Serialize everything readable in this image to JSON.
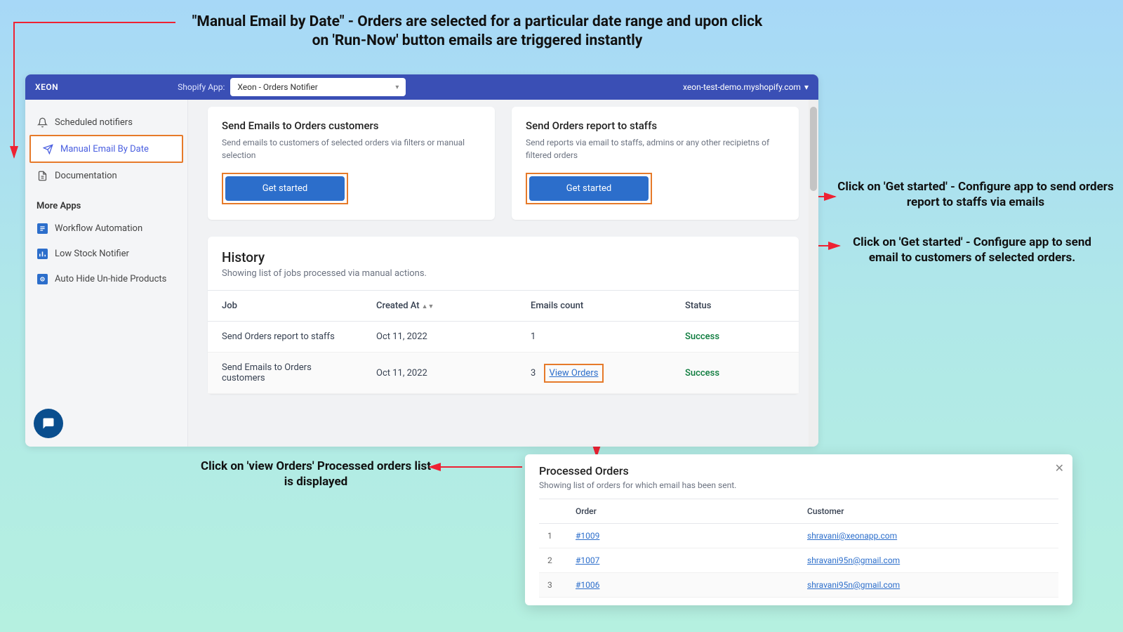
{
  "annotations": {
    "top": "\"Manual Email by Date\" - Orders are selected for a particular date range and upon click on 'Run-Now' button emails are triggered instantly",
    "right1": "Click on 'Get started' - Configure app to send orders report to staffs via emails",
    "right2": "Click on 'Get started' - Configure app to send email to customers of selected orders.",
    "bottom": "Click on 'view Orders' Processed orders list is displayed"
  },
  "topbar": {
    "brand": "XEON",
    "app_label": "Shopify App:",
    "app_selected": "Xeon - Orders Notifier",
    "store": "xeon-test-demo.myshopify.com"
  },
  "sidebar": {
    "items": [
      {
        "label": "Scheduled notifiers"
      },
      {
        "label": "Manual Email By Date"
      },
      {
        "label": "Documentation"
      }
    ],
    "more_label": "More Apps",
    "more": [
      {
        "label": "Workflow Automation"
      },
      {
        "label": "Low Stock Notifier"
      },
      {
        "label": "Auto Hide Un-hide Products"
      }
    ]
  },
  "cards": {
    "c1": {
      "title": "Send Emails to Orders customers",
      "desc": "Send emails to customers of selected orders via filters or manual selection",
      "btn": "Get started"
    },
    "c2": {
      "title": "Send Orders report to staffs",
      "desc": "Send reports via email to staffs, admins or any other recipietns of filtered orders",
      "btn": "Get started"
    }
  },
  "history": {
    "title": "History",
    "subtitle": "Showing list of jobs processed via manual actions.",
    "cols": {
      "job": "Job",
      "created": "Created At",
      "emails": "Emails count",
      "status": "Status"
    },
    "rows": [
      {
        "job": "Send Orders report to staffs",
        "created": "Oct 11, 2022",
        "count": "1",
        "status": "Success",
        "view": false
      },
      {
        "job": "Send Emails to Orders customers",
        "created": "Oct 11, 2022",
        "count": "3",
        "status": "Success",
        "view": true,
        "view_label": "View Orders"
      }
    ]
  },
  "modal": {
    "title": "Processed Orders",
    "subtitle": "Showing list of orders for which email has been sent.",
    "cols": {
      "order": "Order",
      "customer": "Customer"
    },
    "rows": [
      {
        "i": "1",
        "order": "#1009",
        "customer": "shravani@xeonapp.com"
      },
      {
        "i": "2",
        "order": "#1007",
        "customer": "shravani95n@gmail.com"
      },
      {
        "i": "3",
        "order": "#1006",
        "customer": "shravani95n@gmail.com"
      }
    ]
  }
}
